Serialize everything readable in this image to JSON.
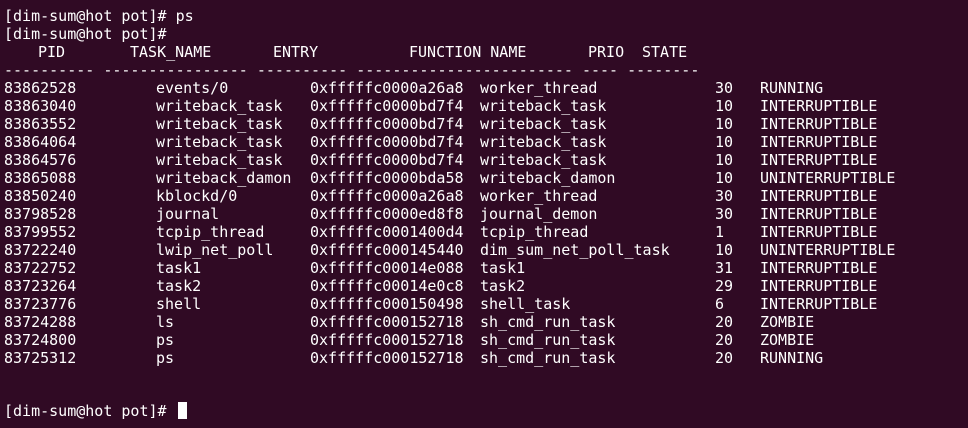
{
  "terminal": {
    "background": "#300a24",
    "foreground": "#ffffff",
    "lines": [
      "[dim-sum@hot pot]# ps",
      "[dim-sum@hot pot]#"
    ],
    "header": {
      "pid": "PID",
      "task_name": "TASK_NAME",
      "entry": "ENTRY",
      "function_name": "FUNCTION NAME",
      "prio": "PRIO",
      "state": "STATE"
    },
    "separator": "---------- ---------------- ---------- ------------------------ ---- --------",
    "rows": [
      {
        "pid": "83862528",
        "task_name": "events/0",
        "entry": "0xfffffc0000a26a8",
        "function": "worker_thread",
        "prio": "30",
        "state": "RUNNING"
      },
      {
        "pid": "83863040",
        "task_name": "writeback_task",
        "entry": "0xfffffc0000bd7f4",
        "function": "writeback_task",
        "prio": "10",
        "state": "INTERRUPTIBLE"
      },
      {
        "pid": "83863552",
        "task_name": "writeback_task",
        "entry": "0xfffffc0000bd7f4",
        "function": "writeback_task",
        "prio": "10",
        "state": "INTERRUPTIBLE"
      },
      {
        "pid": "83864064",
        "task_name": "writeback_task",
        "entry": "0xfffffc0000bd7f4",
        "function": "writeback_task",
        "prio": "10",
        "state": "INTERRUPTIBLE"
      },
      {
        "pid": "83864576",
        "task_name": "writeback_task",
        "entry": "0xfffffc0000bd7f4",
        "function": "writeback_task",
        "prio": "10",
        "state": "INTERRUPTIBLE"
      },
      {
        "pid": "83865088",
        "task_name": "writeback_damon",
        "entry": "0xfffffc0000bda58",
        "function": "writeback_damon",
        "prio": "10",
        "state": "UNINTERRUPTIBLE"
      },
      {
        "pid": "83850240",
        "task_name": "kblockd/0",
        "entry": "0xfffffc0000a26a8",
        "function": "worker_thread",
        "prio": "30",
        "state": "INTERRUPTIBLE"
      },
      {
        "pid": "83798528",
        "task_name": "journal",
        "entry": "0xfffffc0000ed8f8",
        "function": "journal_demon",
        "prio": "30",
        "state": "INTERRUPTIBLE"
      },
      {
        "pid": "83799552",
        "task_name": "tcpip_thread",
        "entry": "0xfffffc0001400d4",
        "function": "tcpip_thread",
        "prio": "1",
        "state": "INTERRUPTIBLE"
      },
      {
        "pid": "83722240",
        "task_name": "lwip_net_poll",
        "entry": "0xfffffc000145440",
        "function": "dim_sum_net_poll_task",
        "prio": "10",
        "state": "UNINTERRUPTIBLE"
      },
      {
        "pid": "83722752",
        "task_name": "task1",
        "entry": "0xfffffc00014e088",
        "function": "task1",
        "prio": "31",
        "state": "INTERRUPTIBLE"
      },
      {
        "pid": "83723264",
        "task_name": "task2",
        "entry": "0xfffffc00014e0c8",
        "function": "task2",
        "prio": "29",
        "state": "INTERRUPTIBLE"
      },
      {
        "pid": "83723776",
        "task_name": "shell",
        "entry": "0xfffffc000150498",
        "function": "shell_task",
        "prio": "6",
        "state": "INTERRUPTIBLE"
      },
      {
        "pid": "83724288",
        "task_name": "ls",
        "entry": "0xfffffc000152718",
        "function": "sh_cmd_run_task",
        "prio": "20",
        "state": "ZOMBIE"
      },
      {
        "pid": "83724800",
        "task_name": "ps",
        "entry": "0xfffffc000152718",
        "function": "sh_cmd_run_task",
        "prio": "20",
        "state": "ZOMBIE"
      },
      {
        "pid": "83725312",
        "task_name": "ps",
        "entry": "0xfffffc000152718",
        "function": "sh_cmd_run_task",
        "prio": "20",
        "state": "RUNNING"
      }
    ],
    "prompt": "[dim-sum@hot pot]#"
  }
}
